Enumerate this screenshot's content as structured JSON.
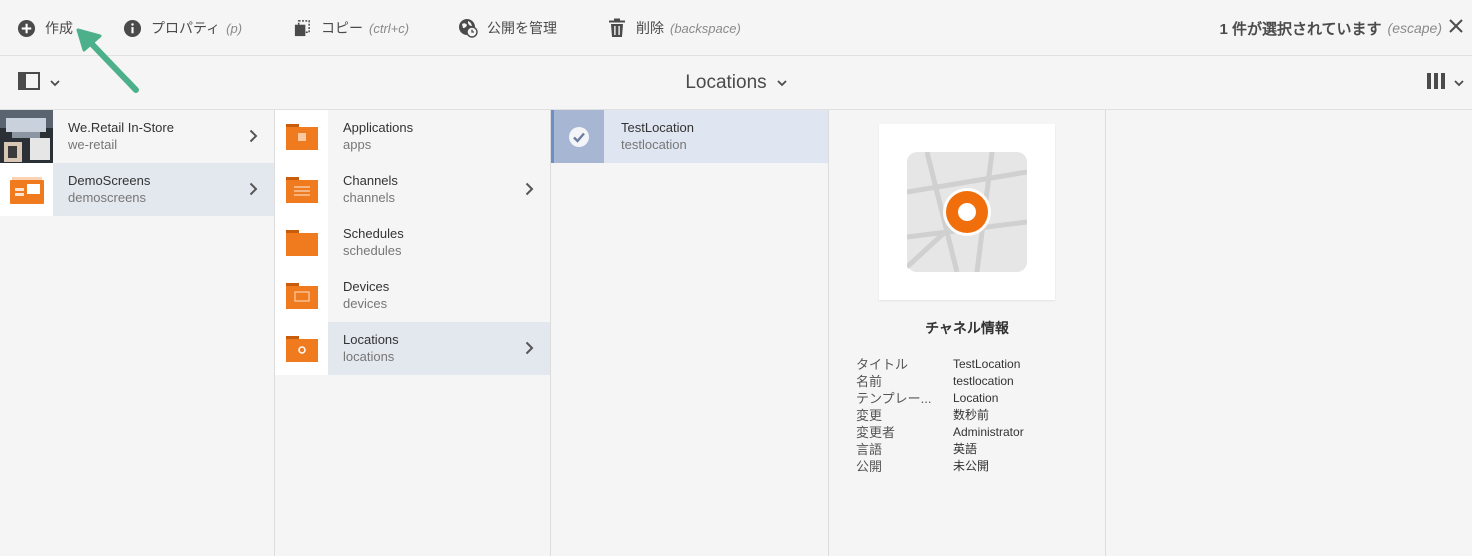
{
  "actionbar": {
    "create": {
      "label": "作成",
      "icon": "plus-circle-icon"
    },
    "properties": {
      "label": "プロパティ",
      "shortcut": "(p)",
      "icon": "info-icon"
    },
    "copy": {
      "label": "コピー",
      "shortcut": "(ctrl+c)",
      "icon": "copy-icon"
    },
    "publish": {
      "label": "公開を管理",
      "icon": "globe-clock-icon"
    },
    "delete": {
      "label": "削除",
      "shortcut": "(backspace)",
      "icon": "trash-icon"
    },
    "selection": {
      "text": "1 件が選択されています",
      "shortcut": "(escape)"
    },
    "close_icon": "close-icon"
  },
  "navbar": {
    "title": "Locations",
    "rail_icon": "rail-toggle-icon",
    "view_icon": "column-view-icon"
  },
  "columns": [
    {
      "items": [
        {
          "title": "We.Retail In-Store",
          "name": "we-retail",
          "thumb": "store-photo"
        },
        {
          "title": "DemoScreens",
          "name": "demoscreens",
          "thumb": "demo-folder",
          "active": true
        }
      ]
    },
    {
      "items": [
        {
          "title": "Applications",
          "name": "apps",
          "icon": "folder-icon"
        },
        {
          "title": "Channels",
          "name": "channels",
          "icon": "folder-icon"
        },
        {
          "title": "Schedules",
          "name": "schedules",
          "icon": "folder-icon"
        },
        {
          "title": "Devices",
          "name": "devices",
          "icon": "folder-icon"
        },
        {
          "title": "Locations",
          "name": "locations",
          "icon": "folder-icon",
          "active": true
        }
      ]
    },
    {
      "items": [
        {
          "title": "TestLocation",
          "name": "testlocation",
          "selected": true
        }
      ]
    }
  ],
  "preview": {
    "heading": "チャネル情報",
    "icon": "location-map-icon",
    "meta": [
      {
        "key": "タイトル",
        "value": "TestLocation"
      },
      {
        "key": "名前",
        "value": "testlocation"
      },
      {
        "key": "テンプレー...",
        "value": "Location"
      },
      {
        "key": "変更",
        "value": "数秒前"
      },
      {
        "key": "変更者",
        "value": "Administrator"
      },
      {
        "key": "言語",
        "value": "英語"
      },
      {
        "key": "公開",
        "value": "未公開"
      }
    ]
  },
  "colors": {
    "accent_orange": "#f06e0c",
    "selected_row": "#dfe6f1",
    "checkmark_bg": "#a6b6d3",
    "arrow_green": "#4cb08a"
  }
}
